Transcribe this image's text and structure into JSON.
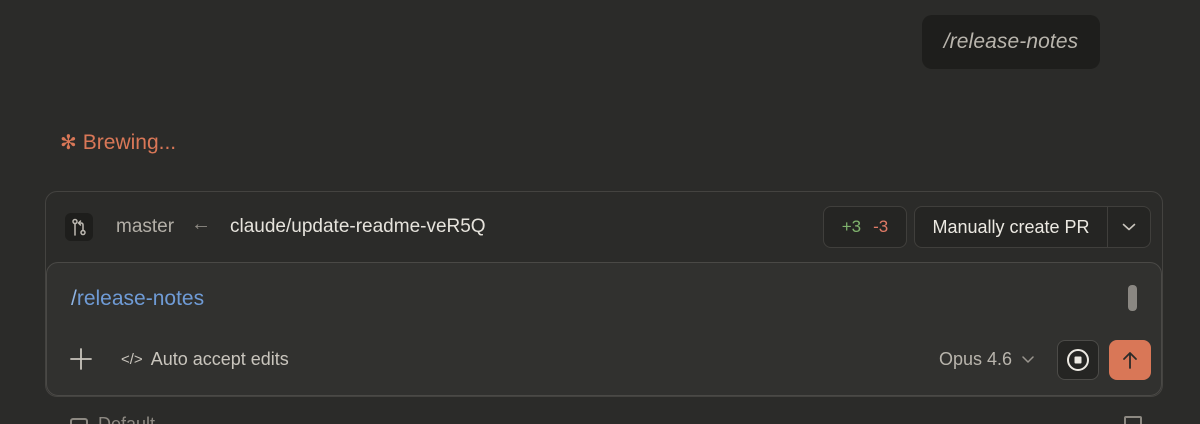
{
  "chat": {
    "user_message": "/release-notes"
  },
  "status": {
    "glyph": "✻",
    "text": "Brewing..."
  },
  "branch_bar": {
    "base_branch": "master",
    "arrow": "←",
    "head_branch": "claude/update-readme-veR5Q",
    "additions": "+3",
    "deletions": "-3",
    "pr_button_label": "Manually create PR"
  },
  "composer": {
    "input_value": "release-notes",
    "input_prefix": "/",
    "accept_label": "Auto accept edits",
    "accept_glyph": "</>",
    "model_label": "Opus 4.6"
  },
  "footer": {
    "label": "Default"
  },
  "colors": {
    "accent": "#d97757",
    "added": "#7fb26d",
    "removed": "#e07a66",
    "command": "#6f9bd6",
    "background": "#2b2b29"
  },
  "icons": {
    "branch": "git-branch-icon",
    "caret": "chevron-down-icon",
    "plus": "plus-icon",
    "stop": "stop-icon",
    "send": "arrow-up-icon",
    "code": "code-icon"
  }
}
